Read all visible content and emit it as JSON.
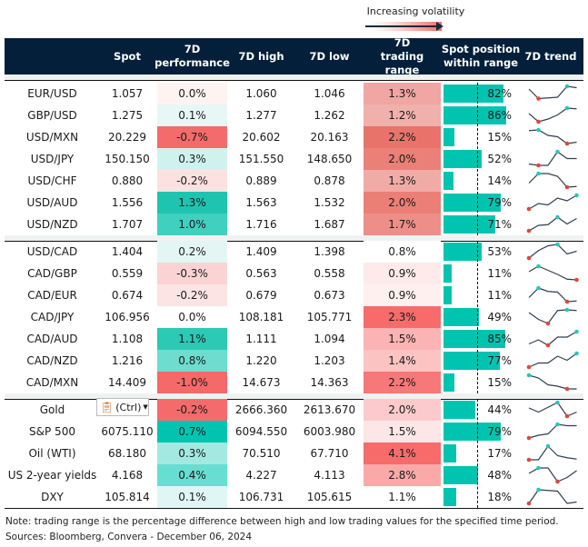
{
  "legend": {
    "label": "Increasing volatility"
  },
  "header": {
    "spot": "Spot",
    "perf": "7D performance",
    "high": "7D high",
    "low": "7D low",
    "range": "7D trading range",
    "position": "Spot position within range",
    "trend": "7D trend"
  },
  "colors": {
    "header_bg": "#031f3a",
    "bar": "#00c4b0",
    "max_marker": "#2ec4b6",
    "min_marker": "#e0463c",
    "line": "#2f3e4e"
  },
  "groups": [
    [
      {
        "name": "EUR/USD",
        "spot": "1.057",
        "perf": "0.0%",
        "perf_bg": "#fff3f2",
        "high": "1.060",
        "low": "1.046",
        "range": "1.3%",
        "range_bg": "#f0a6a2",
        "position": 82,
        "position_label": "82%",
        "trend": [
          0.8,
          0.1,
          0.15,
          0.2,
          1,
          0.9
        ]
      },
      {
        "name": "GBP/USD",
        "spot": "1.275",
        "perf": "0.1%",
        "perf_bg": "#e6f7f5",
        "high": "1.277",
        "low": "1.262",
        "range": "1.2%",
        "range_bg": "#f0b0ab",
        "position": 86,
        "position_label": "86%",
        "trend": [
          0.6,
          0,
          0.2,
          0.5,
          1,
          0.95
        ]
      },
      {
        "name": "USD/MXN",
        "spot": "20.229",
        "perf": "-0.7%",
        "perf_bg": "#f46b6b",
        "high": "20.602",
        "low": "20.163",
        "range": "2.2%",
        "range_bg": "#e8736a",
        "position": 15,
        "position_label": "15%",
        "trend": [
          0.95,
          1,
          0.6,
          0.5,
          0,
          0.1
        ]
      },
      {
        "name": "USD/JPY",
        "spot": "150.150",
        "perf": "0.3%",
        "perf_bg": "#d0f2ee",
        "high": "151.550",
        "low": "148.650",
        "range": "2.0%",
        "range_bg": "#ea8077",
        "position": 52,
        "position_label": "52%",
        "trend": [
          0.1,
          0,
          0,
          1,
          0.5,
          0.5
        ]
      },
      {
        "name": "USD/CHF",
        "spot": "0.880",
        "perf": "-0.2%",
        "perf_bg": "#fde0e0",
        "high": "0.889",
        "low": "0.878",
        "range": "1.3%",
        "range_bg": "#f0aba7",
        "position": 14,
        "position_label": "14%",
        "trend": [
          0.3,
          1,
          1,
          0.8,
          0,
          0.05
        ]
      },
      {
        "name": "USD/AUD",
        "spot": "1.556",
        "perf": "1.3%",
        "perf_bg": "#1fc4b0",
        "high": "1.563",
        "low": "1.532",
        "range": "2.0%",
        "range_bg": "#eb7f76",
        "position": 79,
        "position_label": "79%",
        "trend": [
          0,
          0.4,
          0.3,
          0.8,
          0.6,
          1
        ]
      },
      {
        "name": "USD/NZD",
        "spot": "1.707",
        "perf": "1.0%",
        "perf_bg": "#3fd0c0",
        "high": "1.716",
        "low": "1.687",
        "range": "1.7%",
        "range_bg": "#ed8f88",
        "position": 71,
        "position_label": "71%",
        "trend": [
          0,
          0.4,
          0.45,
          1,
          0.5,
          0.9
        ]
      }
    ],
    [
      {
        "name": "USD/CAD",
        "spot": "1.404",
        "perf": "0.2%",
        "perf_bg": "#e3f6f3",
        "high": "1.409",
        "low": "1.398",
        "range": "0.8%",
        "range_bg": "#ffffff",
        "position": 53,
        "position_label": "53%",
        "trend": [
          0,
          0.55,
          0.9,
          1,
          0.3,
          0.5
        ]
      },
      {
        "name": "CAD/GBP",
        "spot": "0.559",
        "perf": "-0.3%",
        "perf_bg": "#fbd3d3",
        "high": "0.563",
        "low": "0.558",
        "range": "0.9%",
        "range_bg": "#feeaea",
        "position": 11,
        "position_label": "11%",
        "trend": [
          0.6,
          1,
          0.7,
          0.4,
          0.05,
          0
        ]
      },
      {
        "name": "CAD/EUR",
        "spot": "0.674",
        "perf": "-0.2%",
        "perf_bg": "#fde4e4",
        "high": "0.679",
        "low": "0.673",
        "range": "0.9%",
        "range_bg": "#fff0f0",
        "position": 11,
        "position_label": "11%",
        "trend": [
          0.3,
          1,
          0.75,
          0.7,
          0,
          0.05
        ]
      },
      {
        "name": "CAD/JPY",
        "spot": "106.956",
        "perf": "0.0%",
        "perf_bg": "#ffffff",
        "high": "108.181",
        "low": "105.771",
        "range": "2.3%",
        "range_bg": "#f76b6b",
        "position": 49,
        "position_label": "49%",
        "trend": [
          0.8,
          0.3,
          0,
          0.95,
          1,
          0.95
        ]
      },
      {
        "name": "CAD/AUD",
        "spot": "1.108",
        "perf": "1.1%",
        "perf_bg": "#2cc9b5",
        "high": "1.111",
        "low": "1.094",
        "range": "1.5%",
        "range_bg": "#fbb3b3",
        "position": 85,
        "position_label": "85%",
        "trend": [
          0.1,
          0.4,
          0,
          0.6,
          0.6,
          1
        ]
      },
      {
        "name": "CAD/NZD",
        "spot": "1.216",
        "perf": "0.8%",
        "perf_bg": "#6fdcd0",
        "high": "1.220",
        "low": "1.203",
        "range": "1.4%",
        "range_bg": "#fcc3c3",
        "position": 77,
        "position_label": "77%",
        "trend": [
          0,
          0.3,
          0.3,
          0.8,
          0.5,
          1
        ]
      },
      {
        "name": "CAD/MXN",
        "spot": "14.409",
        "perf": "-1.0%",
        "perf_bg": "#f56969",
        "high": "14.673",
        "low": "14.363",
        "range": "2.2%",
        "range_bg": "#f77878",
        "position": 15,
        "position_label": "15%",
        "trend": [
          1,
          0.8,
          0.3,
          0.2,
          0,
          0
        ]
      }
    ],
    [
      {
        "name": "Gold",
        "spot": "",
        "perf": "-0.2%",
        "perf_bg": "#f56b6b",
        "high": "2666.360",
        "low": "2613.670",
        "range": "2.0%",
        "range_bg": "#fccaca",
        "position": 44,
        "position_label": "44%",
        "trend": [
          0.6,
          0.3,
          0.65,
          1,
          0,
          0.3
        ]
      },
      {
        "name": "S&P 500",
        "spot": "6075.110",
        "perf": "0.7%",
        "perf_bg": "#00c4b0",
        "high": "6094.550",
        "low": "6003.980",
        "range": "1.5%",
        "range_bg": "#fde6e6",
        "position": 79,
        "position_label": "79%",
        "trend": [
          0,
          0.2,
          0.3,
          1,
          0.9,
          0.9
        ]
      },
      {
        "name": "Oil (WTI)",
        "spot": "68.180",
        "perf": "0.3%",
        "perf_bg": "#a3e9e2",
        "high": "70.510",
        "low": "67.710",
        "range": "4.1%",
        "range_bg": "#f76b6b",
        "position": 17,
        "position_label": "17%",
        "trend": [
          0,
          0,
          1,
          0.3,
          0.15,
          0.05
        ]
      },
      {
        "name": "US 2-year yields",
        "spot": "4.168",
        "perf": "0.4%",
        "perf_bg": "#68ddd1",
        "high": "4.227",
        "low": "4.113",
        "range": "2.8%",
        "range_bg": "#faa9a9",
        "position": 48,
        "position_label": "48%",
        "trend": [
          0.6,
          1,
          1,
          0,
          0.3,
          0.8
        ]
      },
      {
        "name": "DXY",
        "spot": "105.814",
        "perf": "0.1%",
        "perf_bg": "#e0f6f4",
        "high": "106.731",
        "low": "105.615",
        "range": "1.1%",
        "range_bg": "#ffffff",
        "position": 18,
        "position_label": "18%",
        "trend": [
          0,
          1,
          0.95,
          0.9,
          0,
          0.1
        ]
      }
    ]
  ],
  "paste_popup": {
    "label": "(Ctrl)"
  },
  "notes": {
    "note": "Note: trading range is the percentage difference between high and low trading values for the specified time period.",
    "sources": "Sources: Bloomberg, Convera - December 06, 2024"
  }
}
